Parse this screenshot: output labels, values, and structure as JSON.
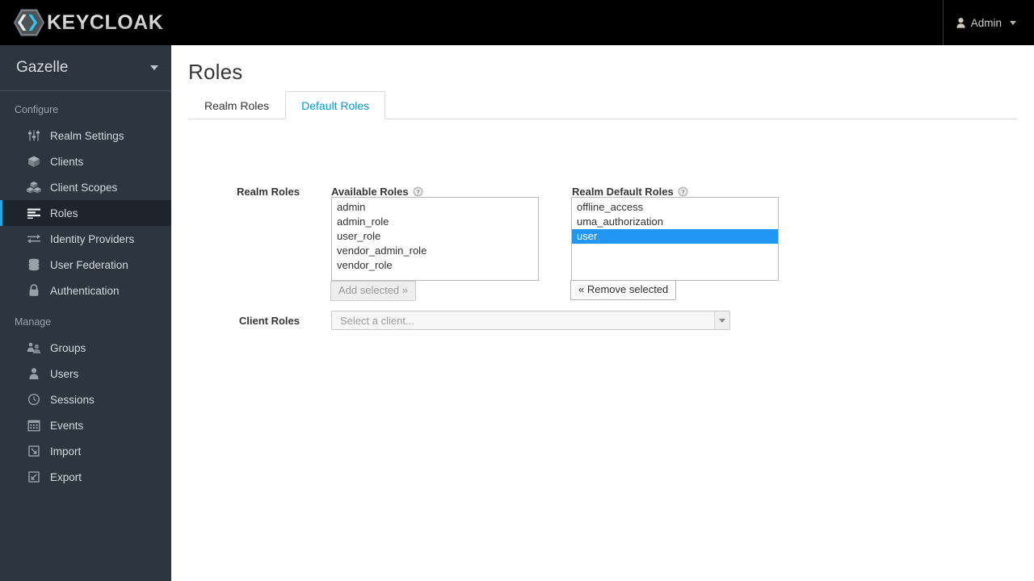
{
  "header": {
    "brand_text": "KEYCLOAK",
    "brand_icon": "keycloak-hexagon-logo",
    "user_label": "Admin",
    "user_icon": "user-icon",
    "user_caret_icon": "chevron-down-icon"
  },
  "sidebar": {
    "realm": {
      "name": "Gazelle",
      "caret_icon": "chevron-down-icon"
    },
    "sections": [
      {
        "label": "Configure",
        "items": [
          {
            "label": "Realm Settings",
            "icon": "sliders-icon",
            "active": false
          },
          {
            "label": "Clients",
            "icon": "cube-icon",
            "active": false
          },
          {
            "label": "Client Scopes",
            "icon": "cubes-icon",
            "active": false
          },
          {
            "label": "Roles",
            "icon": "list-rows-icon",
            "active": true
          },
          {
            "label": "Identity Providers",
            "icon": "exchange-arrows-icon",
            "active": false
          },
          {
            "label": "User Federation",
            "icon": "database-icon",
            "active": false
          },
          {
            "label": "Authentication",
            "icon": "lock-icon",
            "active": false
          }
        ]
      },
      {
        "label": "Manage",
        "items": [
          {
            "label": "Groups",
            "icon": "users-group-icon",
            "active": false
          },
          {
            "label": "Users",
            "icon": "user-icon",
            "active": false
          },
          {
            "label": "Sessions",
            "icon": "clock-icon",
            "active": false
          },
          {
            "label": "Events",
            "icon": "calendar-icon",
            "active": false
          },
          {
            "label": "Import",
            "icon": "import-arrow-icon",
            "active": false
          },
          {
            "label": "Export",
            "icon": "export-arrow-icon",
            "active": false
          }
        ]
      }
    ]
  },
  "main": {
    "title": "Roles",
    "tabs": [
      {
        "label": "Realm Roles",
        "active": false
      },
      {
        "label": "Default Roles",
        "active": true
      }
    ],
    "realm_roles_row": {
      "label": "Realm Roles",
      "available": {
        "label": "Available Roles",
        "help_icon": "question-circle-icon",
        "options": [
          {
            "label": "admin",
            "selected": false
          },
          {
            "label": "admin_role",
            "selected": false
          },
          {
            "label": "user_role",
            "selected": false
          },
          {
            "label": "vendor_admin_role",
            "selected": false
          },
          {
            "label": "vendor_role",
            "selected": false
          }
        ],
        "button": {
          "label": "Add selected »",
          "disabled": true
        }
      },
      "assigned": {
        "label": "Realm Default Roles",
        "help_icon": "question-circle-icon",
        "options": [
          {
            "label": "offline_access",
            "selected": false
          },
          {
            "label": "uma_authorization",
            "selected": false
          },
          {
            "label": "user",
            "selected": true
          }
        ],
        "button": {
          "label": "« Remove selected",
          "disabled": false
        }
      }
    },
    "client_roles_row": {
      "label": "Client Roles",
      "select": {
        "placeholder": "Select a client...",
        "value": "Select a client...",
        "arrow_icon": "caret-down-icon"
      }
    }
  },
  "colors": {
    "accent": "#2aa5dd",
    "tab_active": "#0099d3",
    "selection": "#2196f3",
    "sidebar_bg": "#2d3540",
    "sidebar_active_bg": "#1f252d",
    "header_bg": "#000000"
  }
}
